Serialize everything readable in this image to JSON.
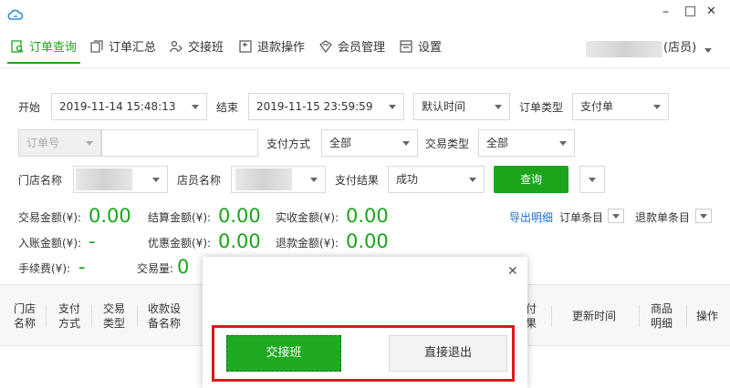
{
  "titlebar": {
    "minimize": "–",
    "maximize": "□",
    "close": "✕"
  },
  "nav": {
    "tabs": [
      {
        "label": "订单查询",
        "icon": "order-search-icon",
        "active": true
      },
      {
        "label": "订单汇总",
        "icon": "order-summary-icon",
        "active": false
      },
      {
        "label": "交接班",
        "icon": "shift-handover-icon",
        "active": false
      },
      {
        "label": "退款操作",
        "icon": "refund-icon",
        "active": false
      },
      {
        "label": "会员管理",
        "icon": "member-icon",
        "active": false
      },
      {
        "label": "设置",
        "icon": "settings-icon",
        "active": false
      }
    ],
    "user_role": "(店员)",
    "accent": "#1aa51a"
  },
  "filters": {
    "start_label": "开始",
    "start_value": "2019-11-14   15:48:13",
    "end_label": "结束",
    "end_value": "2019-11-15   23:59:59",
    "time_type": "默认时间",
    "order_type_label": "订单类型",
    "order_type_value": "支付单",
    "order_no_select": "订单号",
    "pay_method_label": "支付方式",
    "pay_method_value": "全部",
    "trade_type_label": "交易类型",
    "trade_type_value": "全部",
    "store_label": "门店名称",
    "clerk_label": "店员名称",
    "pay_result_label": "支付结果",
    "pay_result_value": "成功",
    "query_button": "查询"
  },
  "stats": {
    "trade_amount_label": "交易金额(¥):",
    "trade_amount": "0.00",
    "settle_amount_label": "结算金额(¥):",
    "settle_amount": "0.00",
    "received_amount_label": "实收金额(¥):",
    "received_amount": "0.00",
    "credited_amount_label": "入账金额(¥):",
    "credited_amount": "-",
    "discount_amount_label": "优惠金额(¥):",
    "discount_amount": "0.00",
    "refund_amount_label": "退款金额(¥):",
    "refund_amount": "0.00",
    "fee_label": "手续费(¥):",
    "fee": "-",
    "trade_count_label": "交易量:",
    "trade_count": "0",
    "export_link": "导出明细",
    "order_items_label": "订单条目",
    "refund_items_label": "退款单条目"
  },
  "table": {
    "headers": [
      "门店\n名称",
      "支付\n方式",
      "交易\n类型",
      "收款设\n备名称",
      "付\n果",
      "更新时间",
      "商品\n明细",
      "操作"
    ]
  },
  "dialog": {
    "close": "✕",
    "handover_button": "交接班",
    "exit_button": "直接退出",
    "highlight_color": "#e0161b"
  }
}
